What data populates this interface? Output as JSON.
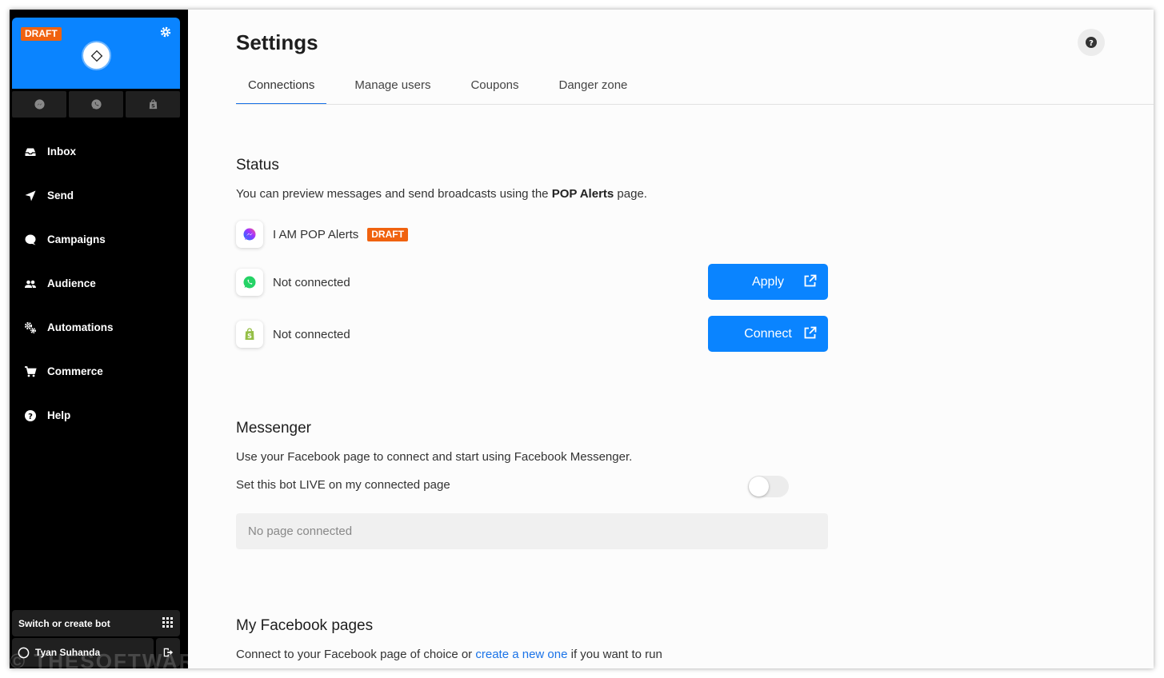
{
  "sidebar": {
    "bot_status_badge": "DRAFT",
    "nav_items": [
      {
        "label": "Inbox",
        "icon": "inbox-icon"
      },
      {
        "label": "Send",
        "icon": "send-icon"
      },
      {
        "label": "Campaigns",
        "icon": "chat-bubble-icon"
      },
      {
        "label": "Audience",
        "icon": "people-icon"
      },
      {
        "label": "Automations",
        "icon": "gears-icon"
      },
      {
        "label": "Commerce",
        "icon": "cart-icon"
      },
      {
        "label": "Help",
        "icon": "question-icon"
      }
    ],
    "switch_bot_label": "Switch or create bot",
    "user_name": "Tyan Suhanda"
  },
  "header": {
    "title": "Settings",
    "tabs": [
      {
        "label": "Connections",
        "active": true
      },
      {
        "label": "Manage users",
        "active": false
      },
      {
        "label": "Coupons",
        "active": false
      },
      {
        "label": "Danger zone",
        "active": false
      }
    ]
  },
  "status": {
    "title": "Status",
    "desc_prefix": "You can preview messages and send broadcasts using the ",
    "desc_bold": "POP Alerts",
    "desc_suffix": " page.",
    "messenger_label": "I AM POP Alerts",
    "messenger_badge": "DRAFT",
    "whatsapp_label": "Not connected",
    "whatsapp_button": "Apply",
    "shopify_label": "Not connected",
    "shopify_button": "Connect"
  },
  "messenger": {
    "title": "Messenger",
    "desc": "Use your Facebook page to connect and start using Facebook Messenger.",
    "live_label": "Set this bot LIVE on my connected page",
    "live_enabled": false,
    "no_page": "No page connected"
  },
  "facebook_pages": {
    "title": "My Facebook pages",
    "desc_prefix": "Connect to your Facebook page of choice or ",
    "desc_link": "create a new one",
    "desc_suffix": " if you want to run"
  },
  "watermark": "© THESOFTWARE.SHOP",
  "colors": {
    "accent": "#0a84ff",
    "badge": "#f0620f",
    "sidebar_bg": "#000000",
    "link": "#1a73e8"
  }
}
